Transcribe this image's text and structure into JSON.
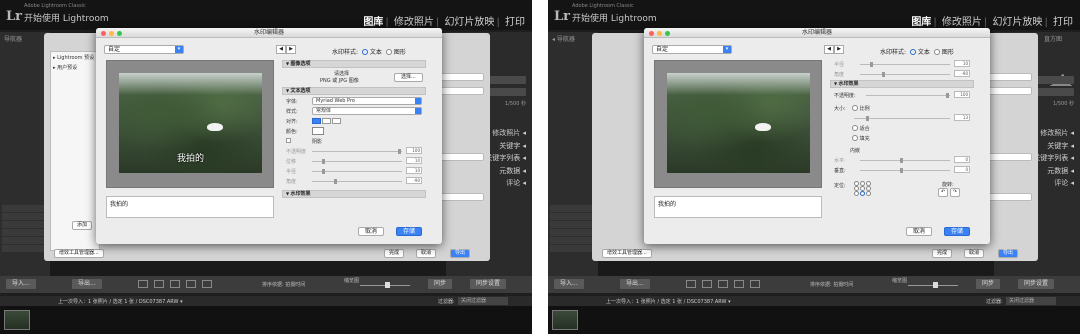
{
  "lr": {
    "logo": "Lr",
    "small_title": "Adobe Lightroom Classic",
    "app_name": "开始使用 Lightroom",
    "modules": [
      "图库",
      "修改照片",
      "幻灯片放映",
      "打印"
    ],
    "navigator": "导航器",
    "histogram": "直方图",
    "exposure_readout": "1/500 秒",
    "right_panel": [
      "修改照片",
      "关键字",
      "关键字列表",
      "元数据",
      "评论"
    ],
    "import_btn": "导入...",
    "export_btn": "导出...",
    "sort_label": "排序依据:",
    "sort_value": "拍摄时间",
    "thumbs_label": "缩览图",
    "sync_btn": "同步",
    "sync_settings_btn": "同步设置",
    "filmstrip_text": "上一次导入：1 张照片 / 选定 1 张 / DSC07387.ARW ▾",
    "filter_label": "过滤器:",
    "filter_value": "关闭过滤器"
  },
  "bg_dialog": {
    "list": [
      "▸ Lightroom 预设",
      "▸ 用户预设"
    ],
    "add_btn": "添加",
    "plugin_btn": "增效工具管理器...",
    "done_btn": "完成",
    "cancel_btn": "取消",
    "export_btn": "导出"
  },
  "dialog": {
    "title": "水印编辑器",
    "preset": "自定",
    "nav_prev": "◀",
    "nav_next": "▶",
    "style_label": "水印样式:",
    "style_text": "文本",
    "style_graphic": "图形",
    "watermark_text": "我拍的",
    "cancel": "取消",
    "save": "存储"
  },
  "left_pane": {
    "section_image": "图像选项",
    "choose_text": "请选择",
    "choose_hint": "PNG 或 JPG 图像",
    "choose_btn": "选择...",
    "section_text": "文本选项",
    "font_label": "字体:",
    "font_value": "Myriad Web Pro",
    "style_label": "样式:",
    "style_value": "常规体",
    "align_label": "对齐:",
    "color_label": "颜色:",
    "shadow_label": "阴影",
    "opacity_label": "不透明度",
    "offset_label": "位移",
    "radius_label": "半径",
    "angle_label": "角度",
    "opacity_val": "100",
    "offset_val": "10",
    "radius_val": "10",
    "angle_val": "-90",
    "section_effects": "水印效果"
  },
  "right_pane": {
    "top_row1": "半径",
    "top_row2": "角度",
    "top_val1": "10",
    "top_val2": "-90",
    "section_effects": "水印效果",
    "opacity_label": "不透明度:",
    "opacity_val": "100",
    "size_label": "大小:",
    "size_proportional": "比例",
    "size_fit": "适合",
    "size_fill": "填充",
    "size_val": "13",
    "inset_label": "内嵌",
    "horizontal_label": "水平:",
    "vertical_label": "垂直:",
    "horizontal_val": "0",
    "vertical_val": "0",
    "anchor_label": "定位:",
    "rotate_label": "旋转:",
    "rotate_left": "↶",
    "rotate_right": "↷"
  }
}
